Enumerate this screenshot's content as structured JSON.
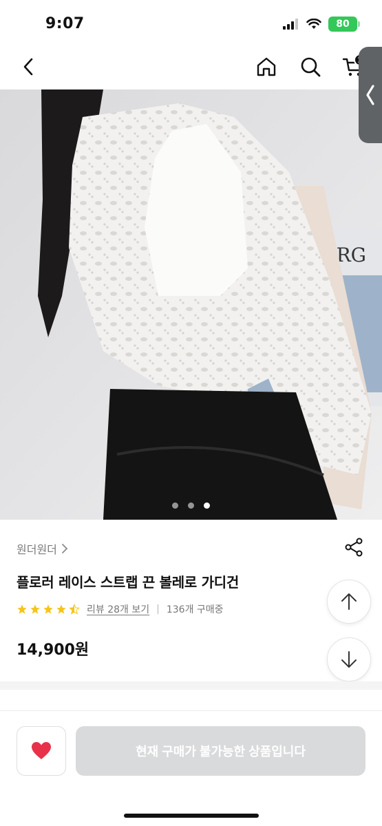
{
  "status": {
    "time": "9:07",
    "battery": "80"
  },
  "nav": {
    "cart_count": "1"
  },
  "image": {
    "sign_text": "INBERG",
    "carousel_count": 3,
    "carousel_active": 3
  },
  "product": {
    "brand": "원더원더",
    "title": "플로러 레이스 스트랩 끈 볼레로 가디건",
    "rating": 4.5,
    "review_link": "리뷰 28개 보기",
    "purchases": "136개 구매중",
    "price": "14,900원"
  },
  "bottom": {
    "buy_label": "현재 구매가 불가능한 상품입니다"
  },
  "colors": {
    "star": "#f5c518",
    "heart": "#e8324a",
    "battery": "#34c759",
    "disabled_button": "#d9dadc"
  }
}
